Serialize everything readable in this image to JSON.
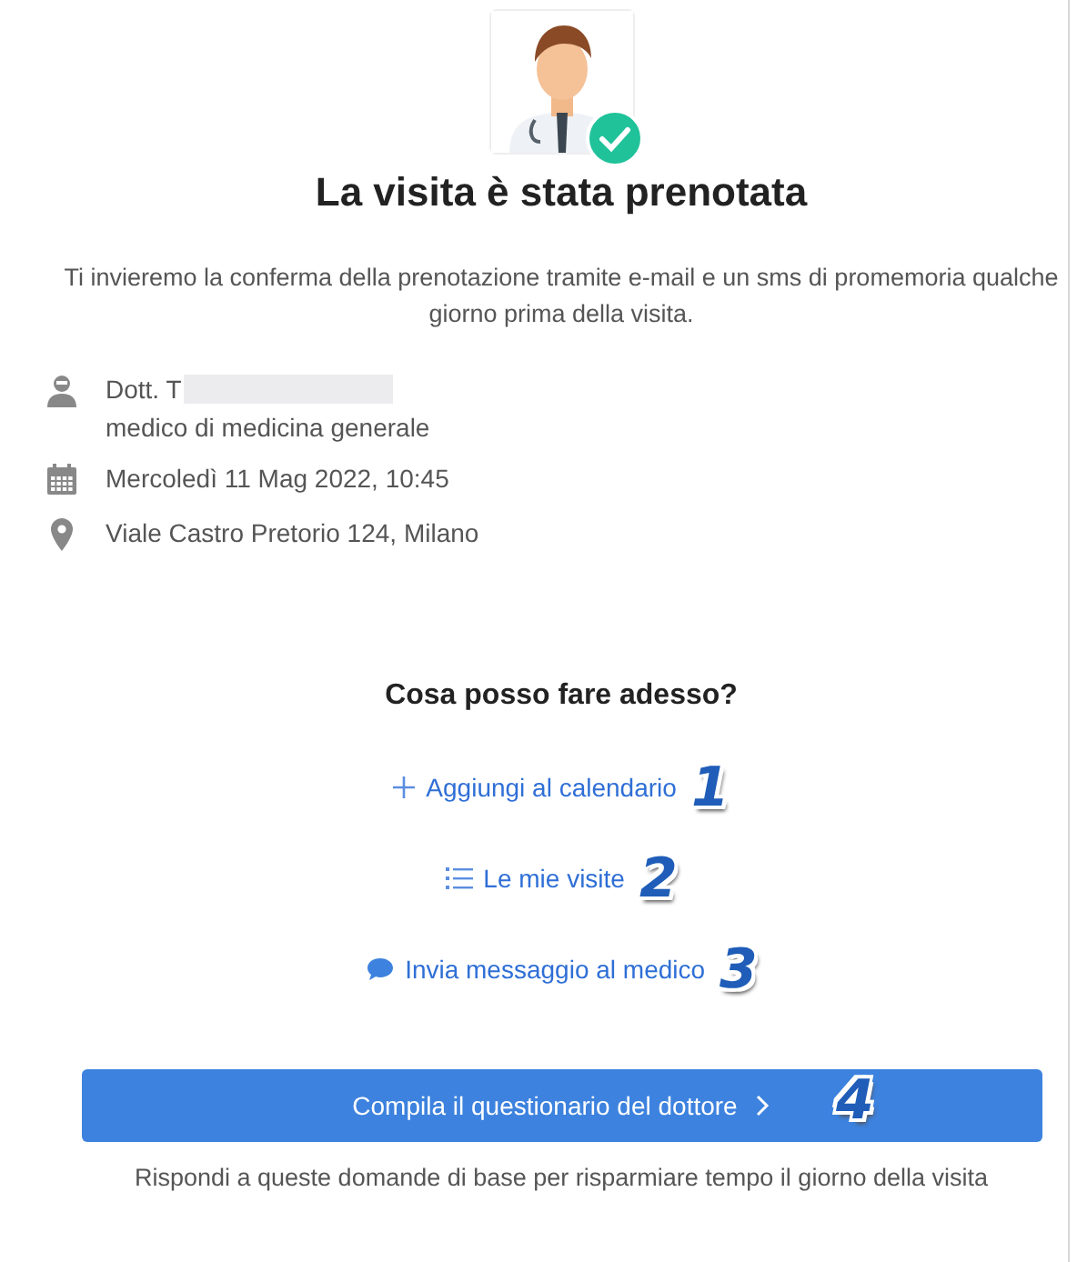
{
  "title": "La visita è stata prenotata",
  "message": "Ti invieremo la conferma della prenotazione tramite e-mail e un sms di promemoria qualche giorno prima della visita.",
  "details": [
    {
      "kind": "doctor",
      "lines": [
        "Dott. T",
        "medico di medicina generale"
      ]
    },
    {
      "kind": "date",
      "lines": [
        "Mercoledì 11 Mag 2022, 10:45"
      ]
    },
    {
      "kind": "place",
      "lines": [
        "Viale Castro Pretorio 124, Milano"
      ]
    }
  ],
  "next_heading": "Cosa posso fare adesso?",
  "actions": [
    {
      "kind": "add",
      "label": "Aggiungi al calendario",
      "callout": "1"
    },
    {
      "kind": "list",
      "label": "Le mie visite",
      "callout": "2"
    },
    {
      "kind": "message",
      "label": "Invia messaggio al medico",
      "callout": "3"
    }
  ],
  "primary_button": {
    "label": "Compila il questionario del dottore",
    "callout": "4"
  },
  "hint": "Rispondi a queste domande di base per risparmiare tempo il giorno della visita"
}
